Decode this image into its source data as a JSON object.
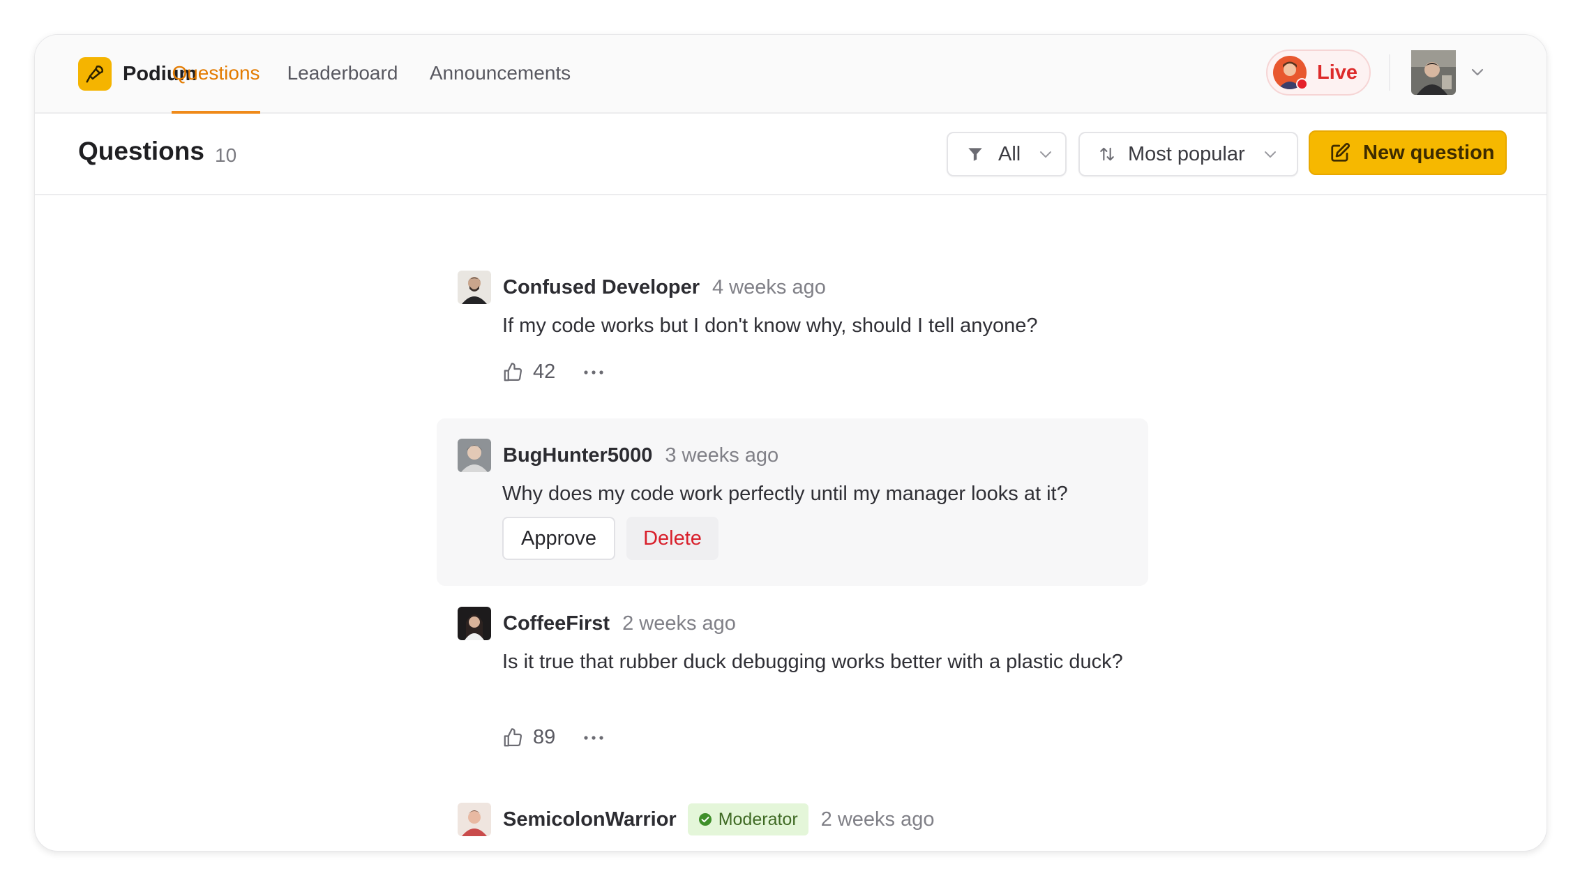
{
  "app": {
    "name": "Podium"
  },
  "nav": {
    "tabs": [
      {
        "label": "Questions",
        "active": true
      },
      {
        "label": "Leaderboard",
        "active": false
      },
      {
        "label": "Announcements",
        "active": false
      }
    ],
    "live_label": "Live"
  },
  "page": {
    "title": "Questions",
    "count": "10",
    "filter": {
      "selected": "All",
      "icon": "filter-icon"
    },
    "sort": {
      "selected": "Most popular",
      "icon": "sort-arrows-icon"
    },
    "new_question_label": "New question"
  },
  "questions": [
    {
      "author": "Confused Developer",
      "time": "4 weeks ago",
      "text": "If my code works but I don't know why, should I tell anyone?",
      "votes": "42"
    },
    {
      "author": "BugHunter5000",
      "time": "3 weeks ago",
      "text": "Why does my code work perfectly until my manager looks at it?",
      "approve_label": "Approve",
      "delete_label": "Delete"
    },
    {
      "author": "CoffeeFirst",
      "time": "2 weeks ago",
      "text": "Is it true that rubber duck debugging works better with a plastic duck?",
      "votes": "89"
    },
    {
      "author": "SemicolonWarrior",
      "badge": "Moderator",
      "time": "2 weeks ago"
    }
  ],
  "colors": {
    "accent": "#f6b800",
    "active_tab": "#e37b00",
    "live": "#dd2b2b",
    "delete": "#d81e2a",
    "moderator_bg": "#e4f6d9"
  }
}
